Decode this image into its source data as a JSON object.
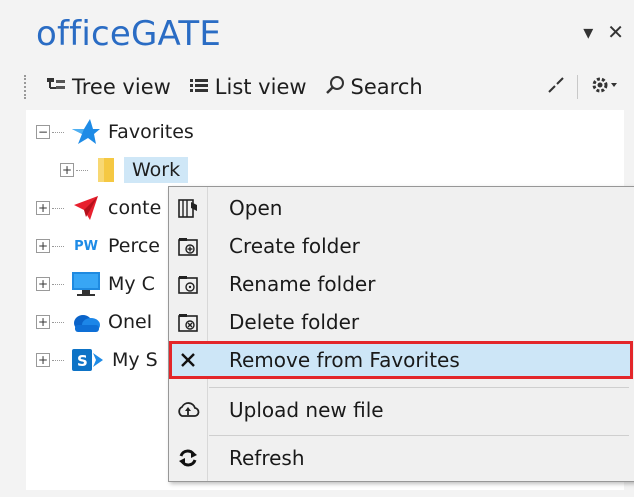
{
  "panel": {
    "title": "officeGATE",
    "controls": {
      "dropdown": "▾",
      "close": "✕"
    }
  },
  "toolbar": {
    "tree_view_label": "Tree view",
    "list_view_label": "List view",
    "search_label": "Search"
  },
  "tree": {
    "items": [
      {
        "label": "Favorites",
        "icon": "star-icon",
        "expander": "−"
      },
      {
        "label": "Work",
        "icon": "folder-icon",
        "expander": "+",
        "selected": true
      },
      {
        "label": "conte",
        "icon": "paper-plane-icon",
        "expander": "+"
      },
      {
        "label": "Perce",
        "icon": "pw-logo-icon",
        "icon_text": "PW",
        "expander": "+"
      },
      {
        "label": "My C",
        "icon": "computer-icon",
        "expander": "+"
      },
      {
        "label": "OneI",
        "icon": "cloud-icon",
        "expander": "+"
      },
      {
        "label": "My S",
        "icon": "sharepoint-icon",
        "icon_text": "S",
        "expander": "+"
      }
    ]
  },
  "context_menu": {
    "items": [
      {
        "label": "Open",
        "icon": "open-icon"
      },
      {
        "label": "Create folder",
        "icon": "create-folder-icon"
      },
      {
        "label": "Rename folder",
        "icon": "rename-folder-icon"
      },
      {
        "label": "Delete folder",
        "icon": "delete-folder-icon"
      },
      {
        "label": "Remove from Favorites",
        "icon": "remove-icon",
        "highlighted": true
      },
      {
        "label": "Upload new file",
        "icon": "upload-icon"
      },
      {
        "label": "Refresh",
        "icon": "refresh-icon"
      }
    ]
  },
  "colors": {
    "title": "#2a6cc4",
    "selection": "#cfe7f7",
    "highlight_outline": "#e3262a",
    "star": "#1e8be6",
    "folder": "#f5c842"
  }
}
